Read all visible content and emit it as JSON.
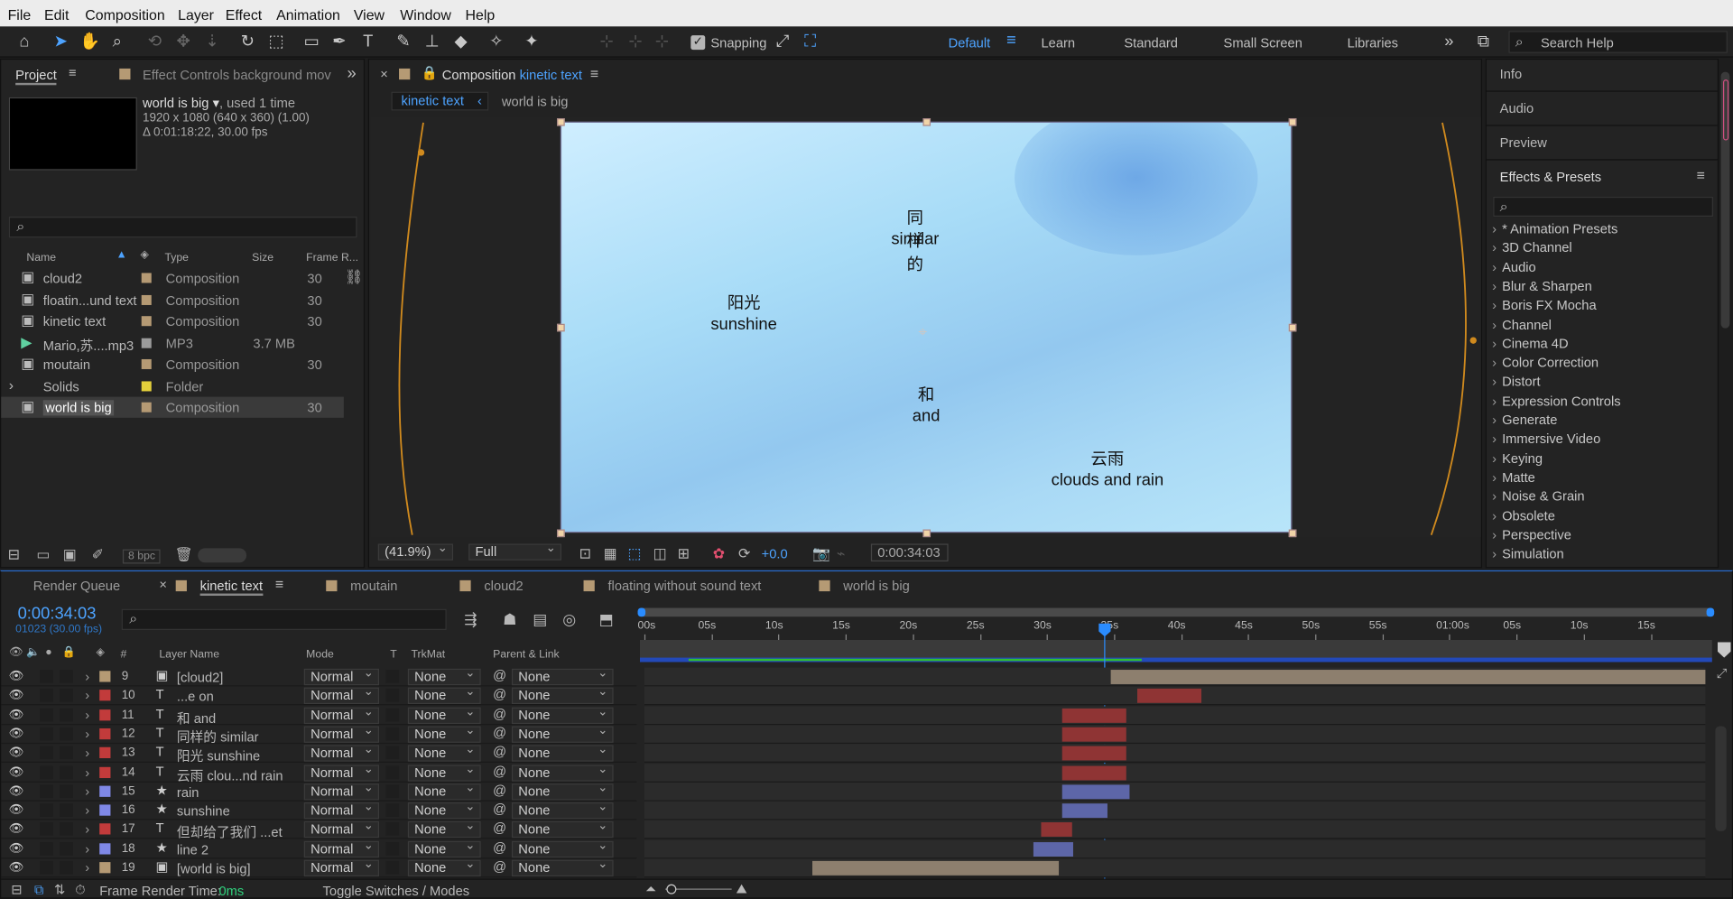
{
  "menu": [
    "File",
    "Edit",
    "Composition",
    "Layer",
    "Effect",
    "Animation",
    "View",
    "Window",
    "Help"
  ],
  "toolbar": {
    "snapping": "Snapping",
    "workspaces": [
      "Default",
      "Learn",
      "Standard",
      "Small Screen",
      "Libraries"
    ],
    "search": "Search Help"
  },
  "project": {
    "tab": "Project",
    "effect_tab": "Effect Controls background mov",
    "comp_name": "world is big",
    "used": ", used 1 time",
    "dims": "1920 x 1080  (640 x 360) (1.00)",
    "duration": "Δ 0:01:18:22, 30.00 fps",
    "headers": [
      "Name",
      "Type",
      "Size",
      "Frame R..."
    ],
    "items": [
      {
        "name": "cloud2",
        "type": "Composition",
        "size": "",
        "fr": "30",
        "color": "#b59a74"
      },
      {
        "name": "floatin...und text",
        "type": "Composition",
        "size": "",
        "fr": "30",
        "color": "#b59a74"
      },
      {
        "name": "kinetic text",
        "type": "Composition",
        "size": "",
        "fr": "30",
        "color": "#b59a74"
      },
      {
        "name": "Mario,苏....mp3",
        "type": "MP3",
        "size": "3.7 MB",
        "fr": "",
        "color": "#9b9b9b"
      },
      {
        "name": "moutain",
        "type": "Composition",
        "size": "",
        "fr": "30",
        "color": "#b59a74"
      },
      {
        "name": "Solids",
        "type": "Folder",
        "size": "",
        "fr": "",
        "color": "#e3cf3b"
      },
      {
        "name": "world is big",
        "type": "Composition",
        "size": "",
        "fr": "30",
        "color": "#b59a74"
      }
    ],
    "bpc": "8 bpc"
  },
  "comp": {
    "tab_prefix": "Composition",
    "tab_name": "kinetic text",
    "crumbs": [
      "kinetic text",
      "world is big"
    ],
    "texts": [
      {
        "cn": "同样的",
        "en": "similar"
      },
      {
        "cn": "阳光",
        "en": "sunshine"
      },
      {
        "cn": "和",
        "en": "and"
      },
      {
        "cn": "云雨",
        "en": "clouds and rain"
      }
    ],
    "zoom": "(41.9%)",
    "quality": "Full",
    "exposure": "+0.0",
    "timecode": "0:00:34:03"
  },
  "right": {
    "panels": [
      "Info",
      "Audio",
      "Preview",
      "Effects & Presets"
    ],
    "effects": [
      "* Animation Presets",
      "3D Channel",
      "Audio",
      "Blur & Sharpen",
      "Boris FX Mocha",
      "Channel",
      "Cinema 4D",
      "Color Correction",
      "Distort",
      "Expression Controls",
      "Generate",
      "Immersive Video",
      "Keying",
      "Matte",
      "Noise & Grain",
      "Obsolete",
      "Perspective",
      "Simulation"
    ]
  },
  "timeline": {
    "tabs": [
      "Render Queue",
      "kinetic text",
      "moutain",
      "cloud2",
      "floating without sound text",
      "world is big"
    ],
    "time": "0:00:34:03",
    "frames": "01023 (30.00 fps)",
    "ruler": [
      "00s",
      "05s",
      "10s",
      "15s",
      "20s",
      "25s",
      "30s",
      "35s",
      "40s",
      "45s",
      "50s",
      "55s",
      "01:00s",
      "05s",
      "10s",
      "15s"
    ],
    "headers": {
      "name": "Layer Name",
      "mode": "Mode",
      "t": "T",
      "trk": "TrkMat",
      "parent": "Parent & Link"
    },
    "layers": [
      {
        "num": "9",
        "icon": "▣",
        "name": "[cloud2]",
        "color": "#b59a74",
        "mode": "Normal",
        "trk": "None",
        "parent": "None",
        "start": 0.44,
        "end": 1.0,
        "bar": "#8d7f6e"
      },
      {
        "num": "10",
        "icon": "T",
        "name": "...e on",
        "color": "#c23b3b",
        "mode": "Normal",
        "trk": "None",
        "parent": "None",
        "start": 0.465,
        "end": 0.525,
        "bar": "#8f3434"
      },
      {
        "num": "11",
        "icon": "T",
        "name": "和 and",
        "color": "#c23b3b",
        "mode": "Normal",
        "trk": "None",
        "parent": "None",
        "start": 0.394,
        "end": 0.454,
        "bar": "#8f3434"
      },
      {
        "num": "12",
        "icon": "T",
        "name": "同样的 similar",
        "color": "#c23b3b",
        "mode": "Normal",
        "trk": "None",
        "parent": "None",
        "start": 0.394,
        "end": 0.454,
        "bar": "#8f3434"
      },
      {
        "num": "13",
        "icon": "T",
        "name": "阳光 sunshine",
        "color": "#c23b3b",
        "mode": "Normal",
        "trk": "None",
        "parent": "None",
        "start": 0.394,
        "end": 0.454,
        "bar": "#8f3434"
      },
      {
        "num": "14",
        "icon": "T",
        "name": "云雨 clou...nd rain",
        "color": "#c23b3b",
        "mode": "Normal",
        "trk": "None",
        "parent": "None",
        "start": 0.394,
        "end": 0.454,
        "bar": "#8f3434"
      },
      {
        "num": "15",
        "icon": "★",
        "name": "rain",
        "color": "#7f88e6",
        "mode": "Normal",
        "trk": "None",
        "parent": "None",
        "start": 0.394,
        "end": 0.457,
        "bar": "#5d66a8"
      },
      {
        "num": "16",
        "icon": "★",
        "name": "sunshine",
        "color": "#7f88e6",
        "mode": "Normal",
        "trk": "None",
        "parent": "None",
        "start": 0.394,
        "end": 0.436,
        "bar": "#5d66a8"
      },
      {
        "num": "17",
        "icon": "T",
        "name": "但却给了我们 ...et",
        "color": "#c23b3b",
        "mode": "Normal",
        "trk": "None",
        "parent": "None",
        "start": 0.374,
        "end": 0.403,
        "bar": "#8f3434"
      },
      {
        "num": "18",
        "icon": "★",
        "name": "line 2",
        "color": "#7f88e6",
        "mode": "Normal",
        "trk": "None",
        "parent": "None",
        "start": 0.367,
        "end": 0.404,
        "bar": "#5d66a8"
      },
      {
        "num": "19",
        "icon": "▣",
        "name": "[world is big]",
        "color": "#b59a74",
        "mode": "Normal",
        "trk": "None",
        "parent": "None",
        "start": 0.158,
        "end": 0.391,
        "bar": "#8d7f6e"
      }
    ],
    "footer_label": "Frame Render Time:",
    "footer_value": "0ms",
    "toggle": "Toggle Switches / Modes"
  }
}
